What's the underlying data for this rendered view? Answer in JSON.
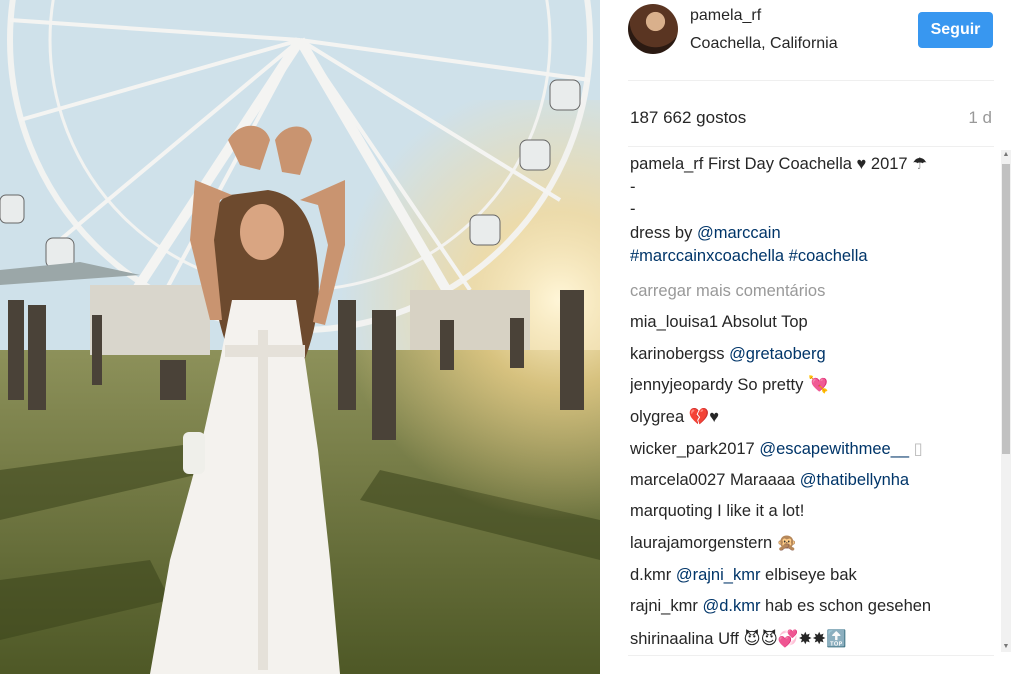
{
  "post": {
    "username": "pamela_rf",
    "location": "Coachella, California",
    "follow_label": "Seguir",
    "likes": "187 662 gostos",
    "age": "1 d"
  },
  "caption": {
    "username": "pamela_rf",
    "text": "First Day Coachella ♥ 2017 ☂",
    "dash1": "-",
    "dash2": "-",
    "dress_prefix": "dress by",
    "dress_link": "@marccain",
    "hashtag1": "#marccainxcoachella",
    "hashtag2": "#coachella"
  },
  "load_more": "carregar mais comentários",
  "comments": [
    {
      "user": "mia_louisa1",
      "link": "",
      "text": "Absolut Top"
    },
    {
      "user": "karinobergss",
      "link": "@gretaoberg",
      "text": ""
    },
    {
      "user": "jennyjeopardy",
      "link": "",
      "text": "So pretty 💘"
    },
    {
      "user": "olygrea",
      "link": "",
      "text": "💔♥"
    },
    {
      "user": "wicker_park2017",
      "link": "@escapewithmee__",
      "text": "▯"
    },
    {
      "user": "marcela0027",
      "link": "",
      "text": "Maraaaa",
      "link2": "@thatibellynha"
    },
    {
      "user": "marquoting",
      "link": "",
      "text": "I like it a lot!"
    },
    {
      "user": "laurajamorgenstern",
      "link": "",
      "text": "🙊"
    },
    {
      "user": "d.kmr",
      "link": "@rajni_kmr",
      "text": "elbiseye bak"
    },
    {
      "user": "rajni_kmr",
      "link": "@d.kmr",
      "text": "hab es schon gesehen"
    },
    {
      "user": "shirinaalina",
      "link": "",
      "text": "Uff 😈😈💞✸✸🔝"
    }
  ],
  "colors": {
    "follow_button": "#3897f0",
    "link": "#003569",
    "muted": "#999999"
  }
}
